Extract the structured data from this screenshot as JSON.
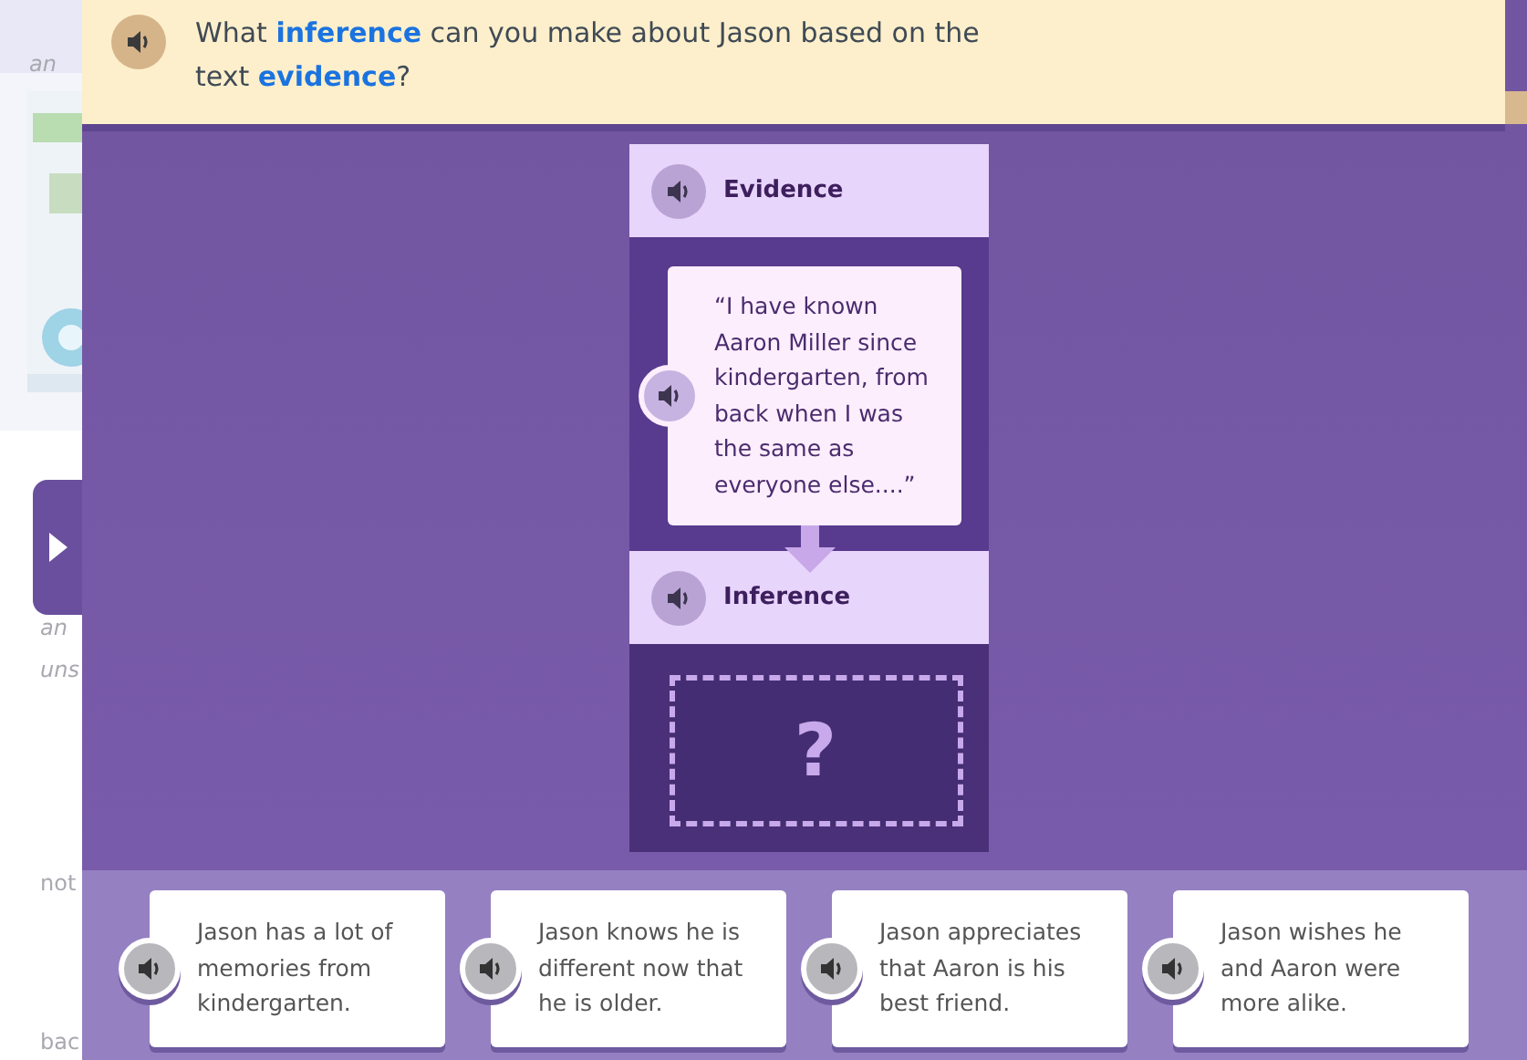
{
  "background_page": {
    "texts": [
      "an",
      "an",
      "uns",
      "not",
      "bac"
    ]
  },
  "question": {
    "text": "What **inference** can you make about Jason based on the text **evidence**?"
  },
  "evidence": {
    "heading": "Evidence",
    "quote": "“I have known Aaron Miller since kindergarten, from back when I was the same as everyone else....”"
  },
  "inference": {
    "heading": "Inference",
    "placeholder": "?"
  },
  "choices": [
    {
      "text": "Jason has a lot of memories from kindergarten."
    },
    {
      "text": "Jason knows he is different now that he is older."
    },
    {
      "text": "Jason appreciates that Aaron is his best friend."
    },
    {
      "text": "Jason wishes he and Aaron were more alike."
    }
  ]
}
